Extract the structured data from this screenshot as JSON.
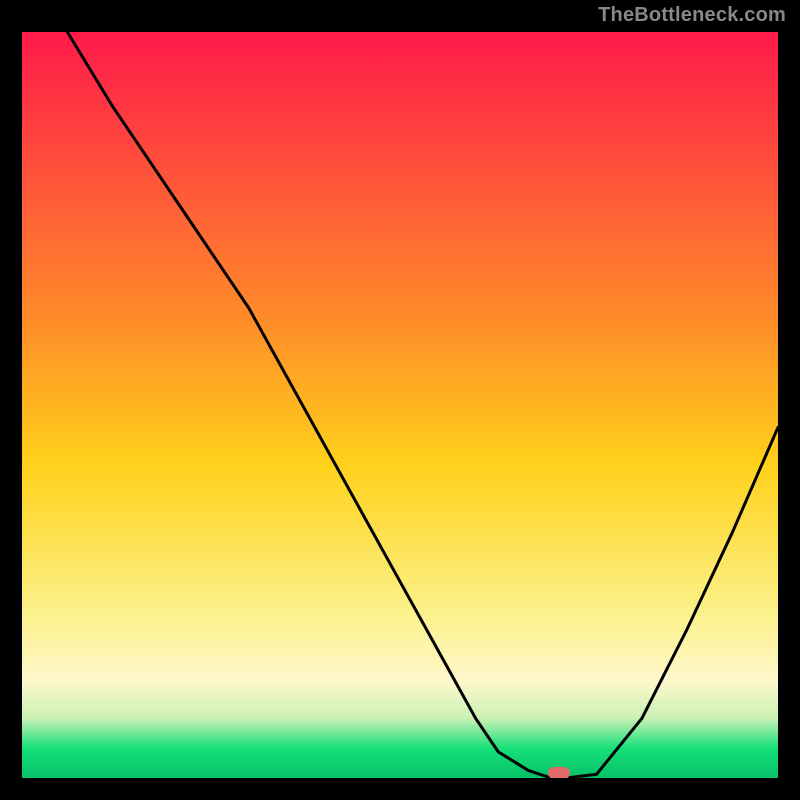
{
  "watermark": "TheBottleneck.com",
  "colors": {
    "top": "#ff1a4a",
    "mid_upper": "#ff8a2a",
    "mid": "#ffd11a",
    "mid_lower": "#fbf18a",
    "pale": "#fff7cc",
    "green_pale": "#c9f2b5",
    "green": "#17e07a",
    "green_deep": "#06c268",
    "marker": "#e26a6a",
    "line": "#000000"
  },
  "chart_data": {
    "type": "line",
    "title": "",
    "xlabel": "",
    "ylabel": "",
    "xlim": [
      0,
      100
    ],
    "ylim": [
      0,
      100
    ],
    "series": [
      {
        "name": "curve",
        "x": [
          6,
          12,
          18,
          24,
          30,
          36,
          42,
          48,
          54,
          60,
          63,
          67,
          70,
          72,
          76,
          82,
          88,
          94,
          100
        ],
        "y": [
          100,
          90,
          81,
          72,
          63,
          52,
          41,
          30,
          19,
          8,
          3.5,
          1,
          0,
          0,
          0.5,
          8,
          20,
          33,
          47
        ]
      }
    ],
    "marker": {
      "x": 71,
      "y": 0.7
    },
    "gradient_stops": [
      {
        "offset": 0,
        "key": "top"
      },
      {
        "offset": 38,
        "key": "mid_upper"
      },
      {
        "offset": 58,
        "key": "mid"
      },
      {
        "offset": 78,
        "key": "mid_lower"
      },
      {
        "offset": 87,
        "key": "pale"
      },
      {
        "offset": 92,
        "key": "green_pale"
      },
      {
        "offset": 96,
        "key": "green"
      },
      {
        "offset": 100,
        "key": "green_deep"
      }
    ]
  }
}
